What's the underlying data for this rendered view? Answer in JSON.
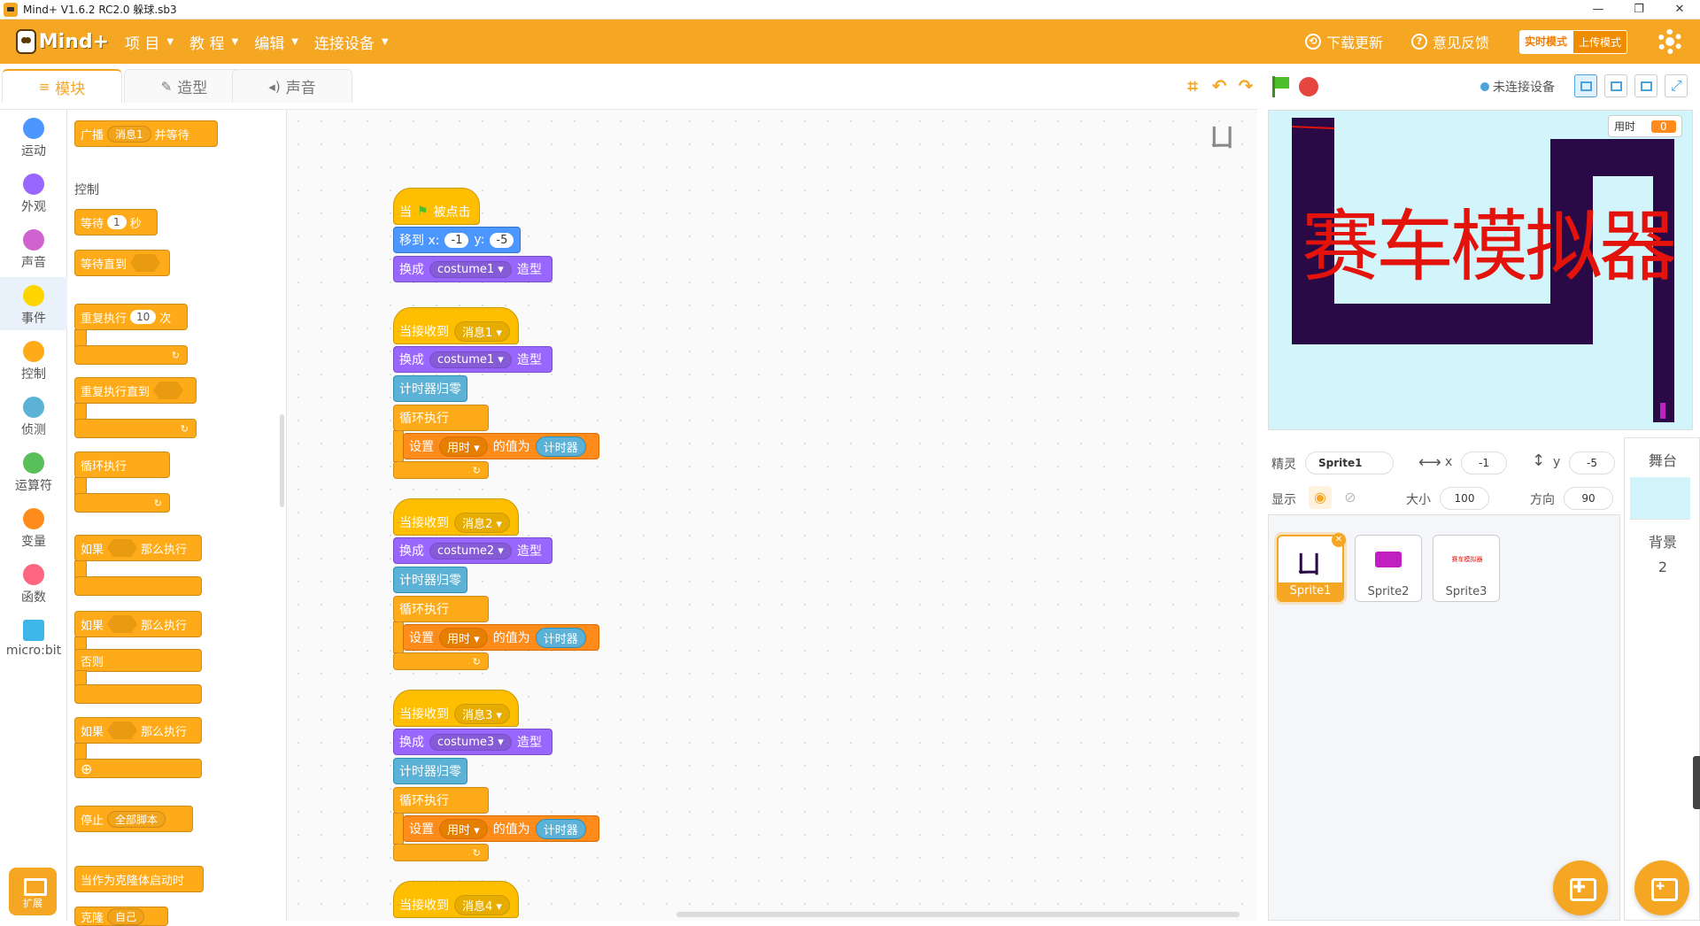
{
  "window": {
    "title": "Mind+ V1.6.2 RC2.0   躲球.sb3",
    "min": "—",
    "max": "❐",
    "close": "✕"
  },
  "menubar": {
    "logo": "Mind+",
    "menus": [
      "项 目",
      "教 程",
      "编辑",
      "连接设备"
    ],
    "download": "下载更新",
    "feedback": "意见反馈",
    "mode_live": "实时模式",
    "mode_upload": "上传模式"
  },
  "tabs": [
    "模块",
    "造型",
    "声音"
  ],
  "toolbar": {
    "connection": "未连接设备"
  },
  "categories": [
    {
      "label": "运动",
      "color": "#4c97ff"
    },
    {
      "label": "外观",
      "color": "#9966ff"
    },
    {
      "label": "声音",
      "color": "#cf63cf"
    },
    {
      "label": "事件",
      "color": "#ffd500"
    },
    {
      "label": "控制",
      "color": "#ffab19"
    },
    {
      "label": "侦测",
      "color": "#5cb1d6"
    },
    {
      "label": "运算符",
      "color": "#59c059"
    },
    {
      "label": "变量",
      "color": "#ff8c1a"
    },
    {
      "label": "函数",
      "color": "#ff6680"
    },
    {
      "label": "micro:bit",
      "color": "#3eb6e8"
    }
  ],
  "ext_label": "扩展",
  "palette": {
    "broadcast": {
      "a": "广播",
      "msg": "消息1",
      "b": "并等待"
    },
    "control_header": "控制",
    "wait": {
      "a": "等待",
      "n": "1",
      "b": "秒"
    },
    "wait_until": "等待直到",
    "repeat": {
      "a": "重复执行",
      "n": "10",
      "b": "次"
    },
    "repeat_until": "重复执行直到",
    "forever": "循环执行",
    "if_then": {
      "a": "如果",
      "b": "那么执行"
    },
    "if_else": {
      "a": "如果",
      "b": "那么执行",
      "c": "否则"
    },
    "if_then2": {
      "a": "如果",
      "b": "那么执行"
    },
    "stop": {
      "a": "停止",
      "opt": "全部脚本"
    },
    "clone_start": "当作为克隆体启动时",
    "clone_create": {
      "a": "克隆",
      "opt": "自己"
    }
  },
  "scripts": {
    "flag_hat": {
      "a": "当",
      "b": "被点击"
    },
    "goto": {
      "a": "移到 x:",
      "x": "-1",
      "b": "y:",
      "y": "-5"
    },
    "switch": "换成",
    "costume_suffix": "造型",
    "costumes": [
      "costume1",
      "costume1",
      "costume2",
      "costume3"
    ],
    "recv": "当接收到",
    "messages": [
      "消息1",
      "消息2",
      "消息3",
      "消息4"
    ],
    "reset_timer": "计时器归零",
    "forever": "循环执行",
    "set": "设置",
    "var": "用时",
    "to": "的值为",
    "timer": "计时器"
  },
  "stage": {
    "title_text": "赛车模拟器",
    "monitor_label": "用时",
    "monitor_value": "0",
    "track_color": "#2a0a46",
    "bg_color": "#d2f4fb"
  },
  "sprite_info": {
    "sprite_label": "精灵",
    "sprite_name": "Sprite1",
    "x_label": "x",
    "x": "-1",
    "y_label": "y",
    "y": "-5",
    "show_label": "显示",
    "size_label": "大小",
    "size": "100",
    "dir_label": "方向",
    "dir": "90"
  },
  "sprites": [
    "Sprite1",
    "Sprite2",
    "Sprite3"
  ],
  "sprite3_thumb_text": "赛车模拟器",
  "stage_col": {
    "title": "舞台",
    "bg_label": "背景",
    "bg_count": "2"
  }
}
